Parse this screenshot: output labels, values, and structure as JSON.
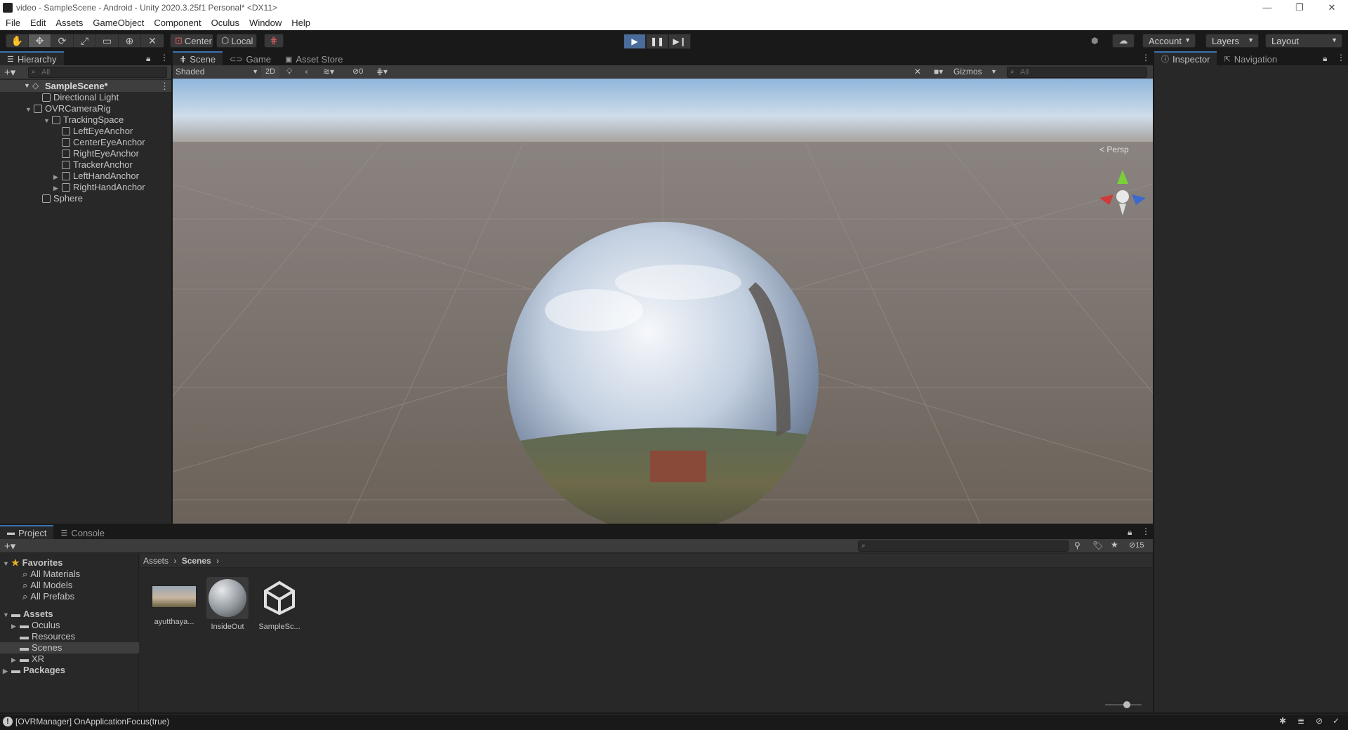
{
  "window": {
    "title": "video - SampleScene - Android - Unity 2020.3.25f1 Personal* <DX11>",
    "controls": [
      "—",
      "❐",
      "✕"
    ]
  },
  "menu": [
    "File",
    "Edit",
    "Assets",
    "GameObject",
    "Component",
    "Oculus",
    "Window",
    "Help"
  ],
  "toolbar": {
    "pivot_label": "Center",
    "space_label": "Local",
    "account_label": "Account",
    "layers_label": "Layers",
    "layout_label": "Layout"
  },
  "hierarchy": {
    "tab_label": "Hierarchy",
    "search_placeholder": "All",
    "scene_name": "SampleScene*",
    "items": [
      {
        "label": "Directional Light"
      },
      {
        "label": "OVRCameraRig"
      },
      {
        "label": "TrackingSpace"
      },
      {
        "label": "LeftEyeAnchor"
      },
      {
        "label": "CenterEyeAnchor"
      },
      {
        "label": "RightEyeAnchor"
      },
      {
        "label": "TrackerAnchor"
      },
      {
        "label": "LeftHandAnchor"
      },
      {
        "label": "RightHandAnchor"
      },
      {
        "label": "Sphere"
      }
    ]
  },
  "scene": {
    "tabs": [
      "Scene",
      "Game",
      "Asset Store"
    ],
    "shading_mode": "Shaded",
    "mode_2d": "2D",
    "hidden_count": "0",
    "gizmos_label": "Gizmos",
    "search_placeholder": "All",
    "persp_label": "< Persp"
  },
  "inspector": {
    "tabs": [
      "Inspector",
      "Navigation"
    ]
  },
  "project": {
    "tabs": [
      "Project",
      "Console"
    ],
    "hidden_count": "15",
    "favorites": {
      "label": "Favorites",
      "items": [
        "All Materials",
        "All Models",
        "All Prefabs"
      ]
    },
    "assets_tree": {
      "label": "Assets",
      "items": [
        "Oculus",
        "Resources",
        "Scenes",
        "XR"
      ],
      "selected": "Scenes"
    },
    "packages_label": "Packages",
    "breadcrumb": [
      "Assets",
      "Scenes"
    ],
    "files": [
      {
        "name": "ayutthaya...",
        "kind": "texture"
      },
      {
        "name": "InsideOut",
        "kind": "material"
      },
      {
        "name": "SampleSc...",
        "kind": "scene"
      }
    ]
  },
  "status": {
    "message": "[OVRManager] OnApplicationFocus(true)"
  },
  "colors": {
    "accent": "#3a72b0",
    "play_active": "#4a6c9a",
    "panel": "#282828",
    "background": "#191919"
  }
}
